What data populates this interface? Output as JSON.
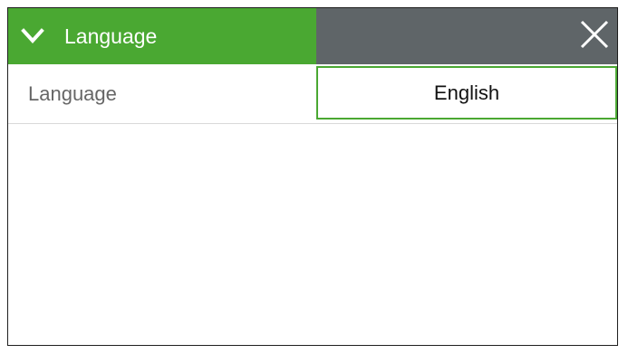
{
  "panel": {
    "title": "Language",
    "expand_icon": "chevron-down-icon",
    "close_icon": "close-icon"
  },
  "rows": [
    {
      "label": "Language",
      "value": "English"
    }
  ],
  "colors": {
    "accent": "#4aa832",
    "header_dark": "#5f6568"
  }
}
